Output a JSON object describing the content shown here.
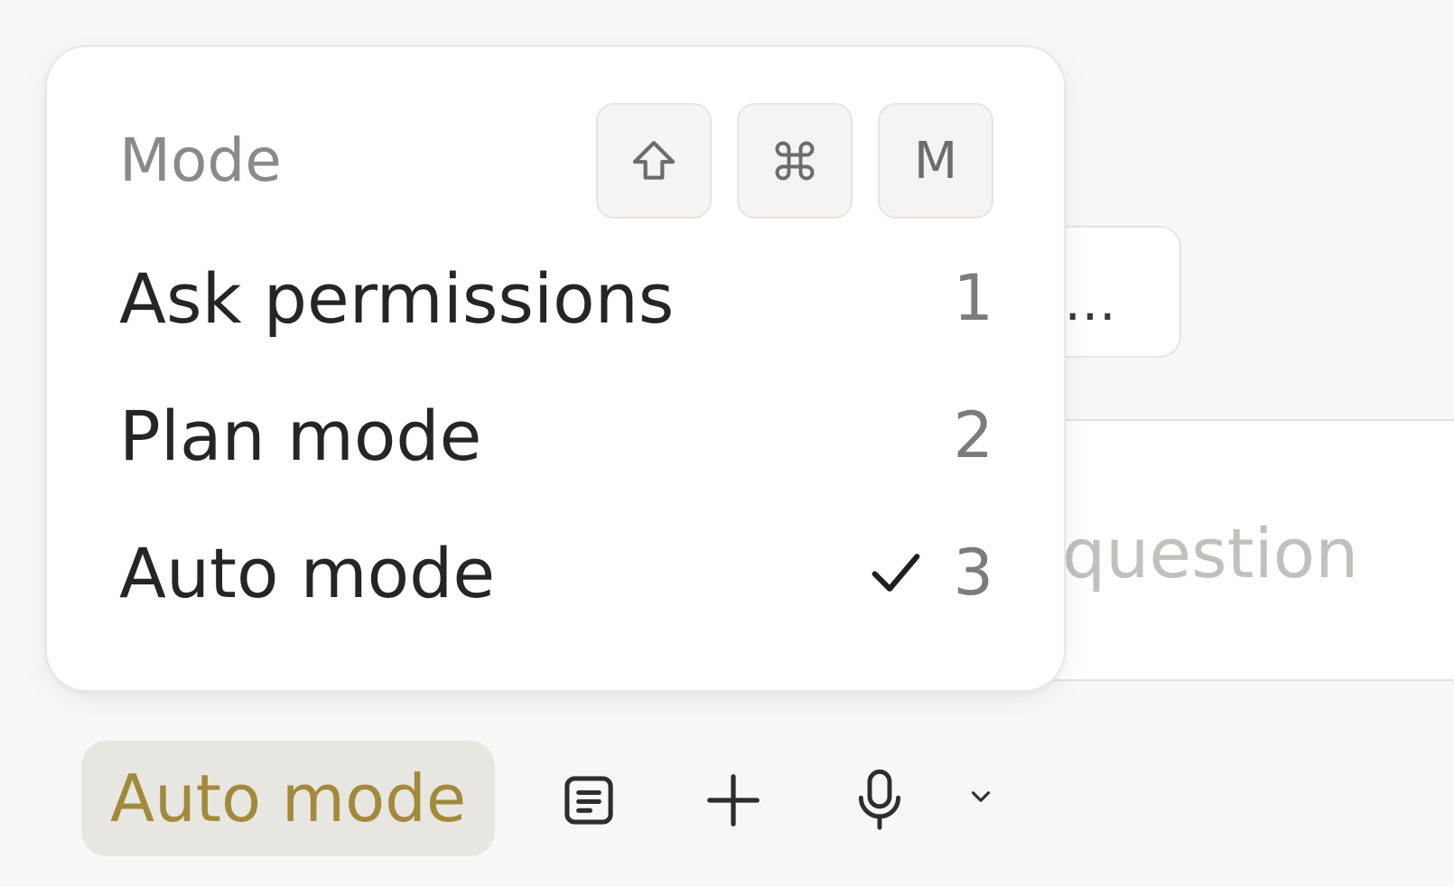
{
  "background": {
    "chip_text": "…",
    "input_placeholder_fragment": "question"
  },
  "menu": {
    "title": "Mode",
    "shortcut_keys": [
      {
        "icon": "shift-icon"
      },
      {
        "icon": "command-icon"
      },
      {
        "label": "M"
      }
    ],
    "items": [
      {
        "label": "Ask permissions",
        "shortcut": "1",
        "selected": false
      },
      {
        "label": "Plan mode",
        "shortcut": "2",
        "selected": false
      },
      {
        "label": "Auto mode",
        "shortcut": "3",
        "selected": true
      }
    ]
  },
  "toolbar": {
    "mode_label": "Auto mode",
    "icons": [
      "notes-icon",
      "plus-icon",
      "microphone-icon",
      "chevron-down-icon"
    ]
  },
  "colors": {
    "mode_accent": "#a28a3c",
    "pill_bg": "#e8e6e1",
    "page_bg": "#f9f8f6"
  }
}
